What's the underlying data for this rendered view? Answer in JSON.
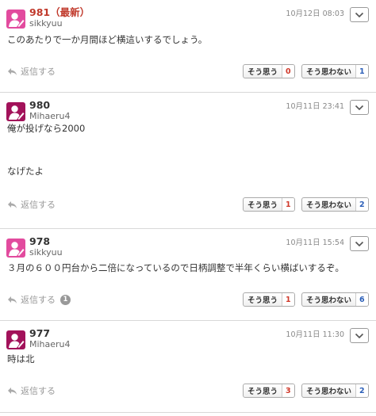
{
  "posts": [
    {
      "number": "981（最新）",
      "latest": true,
      "username": "sikkyuu",
      "date": "10月12日 08:03",
      "body": "このあたりで一か月間ほど横這いするでしょう。",
      "reply_label": "返信する",
      "reply_count": "",
      "agree_label": "そう思う",
      "agree_count": "0",
      "disagree_label": "そう思わない",
      "disagree_count": "1",
      "avatar_color": "#e24b9e"
    },
    {
      "number": "980",
      "latest": false,
      "username": "Mihaeru4",
      "date": "10月11日 23:41",
      "body": "俺が投げなら2000\n\n\nなげたよ",
      "reply_label": "返信する",
      "reply_count": "",
      "agree_label": "そう思う",
      "agree_count": "1",
      "disagree_label": "そう思わない",
      "disagree_count": "2",
      "avatar_color": "#a2125a"
    },
    {
      "number": "978",
      "latest": false,
      "username": "sikkyuu",
      "date": "10月11日 15:54",
      "body": "３月の６００円台から二倍になっているので日柄調整で半年くらい横ばいするぞ。",
      "reply_label": "返信する",
      "reply_count": "1",
      "agree_label": "そう思う",
      "agree_count": "1",
      "disagree_label": "そう思わない",
      "disagree_count": "6",
      "avatar_color": "#e24b9e"
    },
    {
      "number": "977",
      "latest": false,
      "username": "Mihaeru4",
      "date": "10月11日 11:30",
      "body": "時は北",
      "reply_label": "返信する",
      "reply_count": "",
      "agree_label": "そう思う",
      "agree_count": "3",
      "disagree_label": "そう思わない",
      "disagree_count": "2",
      "avatar_color": "#a2125a"
    }
  ]
}
